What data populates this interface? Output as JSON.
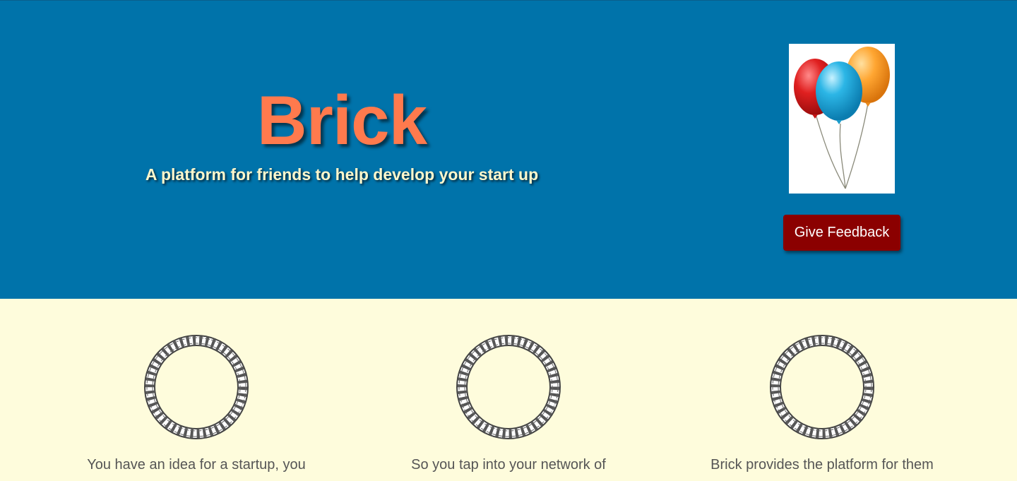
{
  "hero": {
    "title": "Brick",
    "tagline": "A platform for friends to help develop your start up",
    "background_color": "#0073aa",
    "title_color": "#ff7a4d",
    "tagline_color": "#fff7cc",
    "image_icon": "balloons-icon",
    "feedback_button_label": "Give Feedback",
    "feedback_button_color": "#8b0000"
  },
  "features": {
    "background_color": "#fefcdc",
    "items": [
      {
        "icon": "braided-ring-icon",
        "text": "You have an idea for a startup, you"
      },
      {
        "icon": "braided-ring-icon",
        "text": "So you tap into your network of"
      },
      {
        "icon": "braided-ring-icon",
        "text": "Brick provides the platform for them"
      }
    ]
  }
}
